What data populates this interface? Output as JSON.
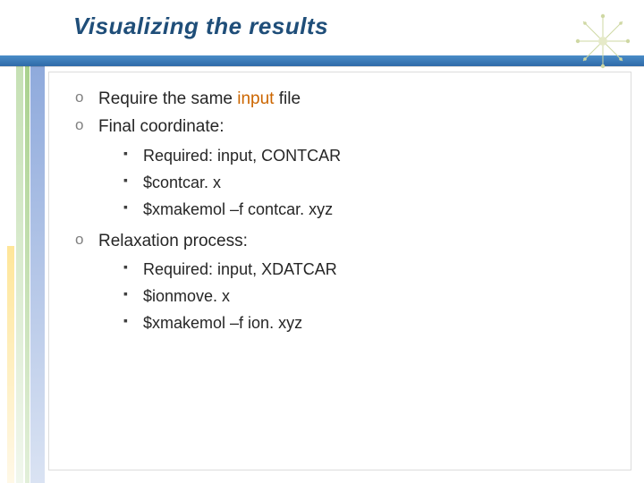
{
  "title": "Visualizing the results",
  "bullets": {
    "b1_pre": "Require the same ",
    "b1_hl": "input",
    "b1_post": " file",
    "b2": "Final coordinate:",
    "b2_sub": {
      "s1": "Required: input, CONTCAR",
      "s2": "$contcar. x",
      "s3": "$xmakemol –f contcar. xyz"
    },
    "b3": "Relaxation process:",
    "b3_sub": {
      "s1": "Required: input, XDATCAR",
      "s2": "$ionmove. x",
      "s3": "$xmakemol –f ion. xyz"
    }
  }
}
